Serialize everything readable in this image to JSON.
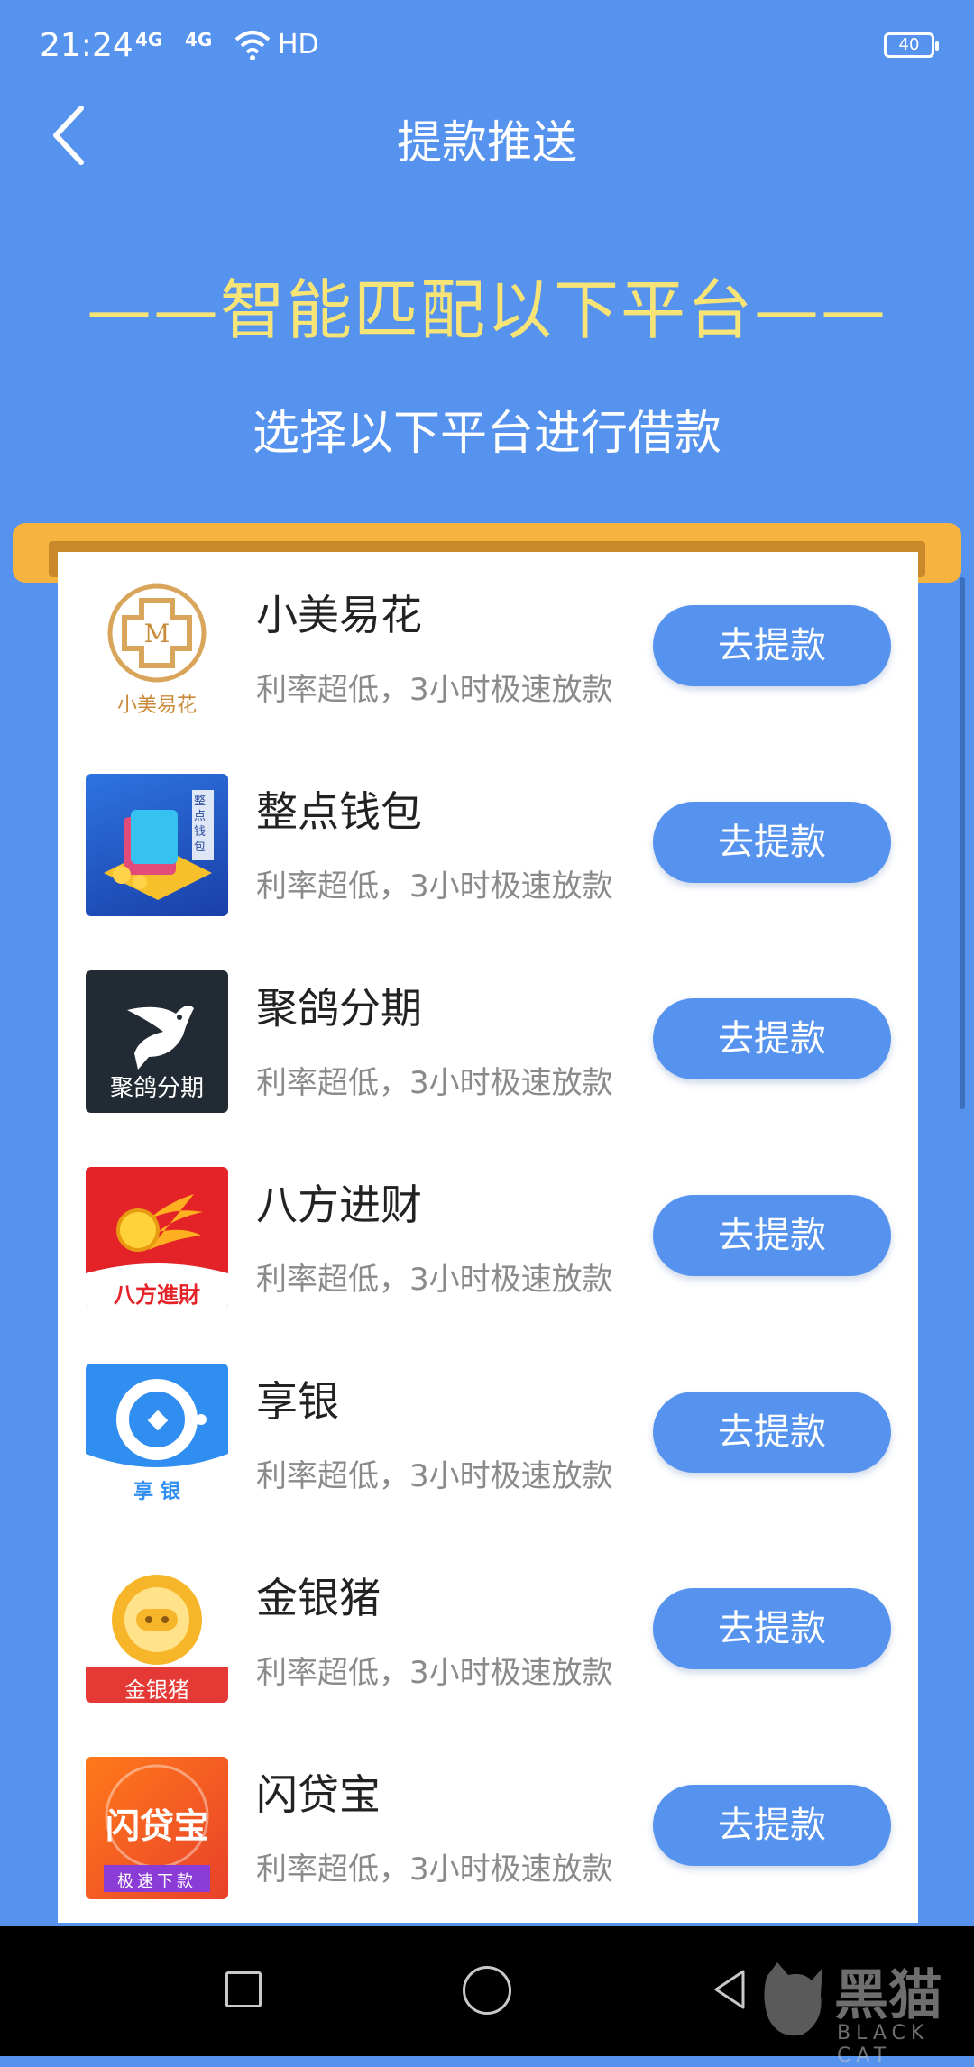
{
  "status_bar": {
    "time": "21:24",
    "signal_1": "4G",
    "signal_2": "4G",
    "hd": "HD",
    "battery": "40"
  },
  "header": {
    "title": "提款推送",
    "headline": "——智能匹配以下平台——",
    "subhead": "选择以下平台进行借款"
  },
  "platforms": [
    {
      "name": "小美易花",
      "desc": "利率超低，3小时极速放款",
      "button": "去提款",
      "logo_label": "小美易花"
    },
    {
      "name": "整点钱包",
      "desc": "利率超低，3小时极速放款",
      "button": "去提款",
      "logo_label": ""
    },
    {
      "name": "聚鸽分期",
      "desc": "利率超低，3小时极速放款",
      "button": "去提款",
      "logo_label": "聚鸽分期"
    },
    {
      "name": "八方进财",
      "desc": "利率超低，3小时极速放款",
      "button": "去提款",
      "logo_label": "八方進財"
    },
    {
      "name": "享银",
      "desc": "利率超低，3小时极速放款",
      "button": "去提款",
      "logo_label": "享 银"
    },
    {
      "name": "金银猪",
      "desc": "利率超低，3小时极速放款",
      "button": "去提款",
      "logo_label": "金银猪"
    },
    {
      "name": "闪贷宝",
      "desc": "利率超低，3小时极速放款",
      "button": "去提款",
      "logo_label": "闪贷宝"
    }
  ],
  "logo_extras": {
    "xiaomei_letter": "M",
    "zhengdian_side": "整点钱包",
    "shandaibao_sub": "极速下款"
  },
  "watermark": {
    "text": "黑猫",
    "sub": "BLACK CAT"
  },
  "colors": {
    "background": "#5693ee",
    "headline": "#f6e477",
    "button": "#5693ee",
    "scroll_bar": "#f6b33f"
  }
}
